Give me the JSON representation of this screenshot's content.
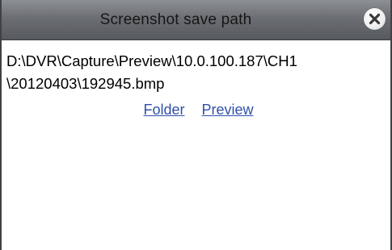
{
  "dialog": {
    "title": "Screenshot save path",
    "close_icon": "close-circle-icon"
  },
  "content": {
    "path_line_1": "D:\\DVR\\Capture\\Preview\\10.0.100.187\\CH1",
    "path_line_2": "\\20120403\\192945.bmp"
  },
  "actions": {
    "folder_label": "Folder",
    "preview_label": "Preview"
  },
  "colors": {
    "titlebar": "#6b6e73",
    "link": "#2f50a8",
    "border": "#3f4145"
  }
}
